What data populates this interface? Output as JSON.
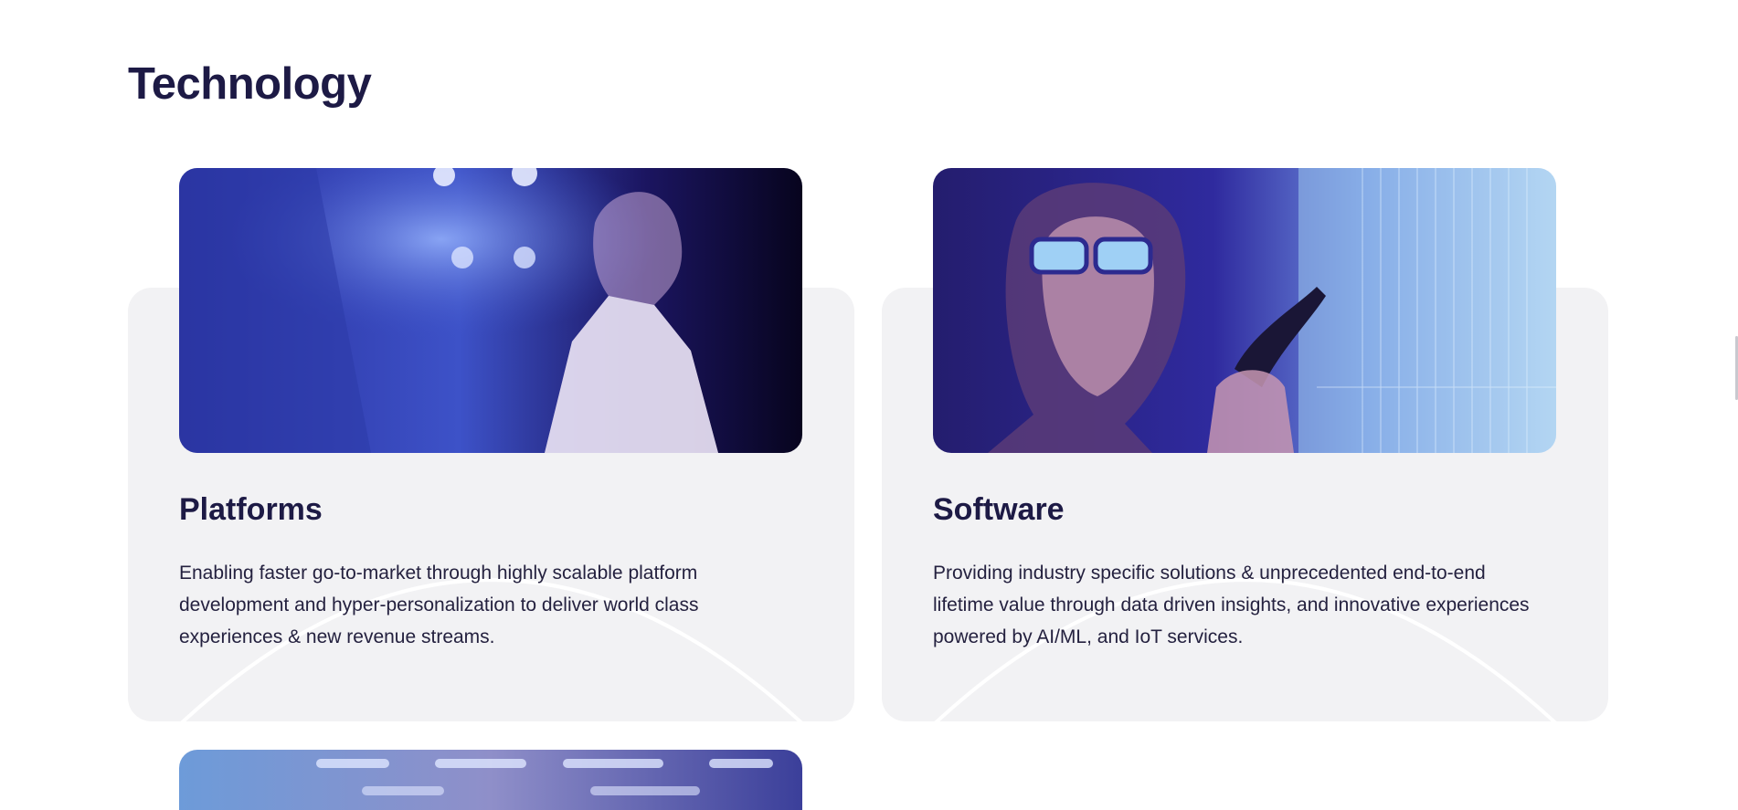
{
  "section": {
    "title": "Technology"
  },
  "cards": [
    {
      "title": "Platforms",
      "description": "Enabling faster go-to-market through highly scalable platform development and hyper-personalization to deliver world class experiences & new revenue streams."
    },
    {
      "title": "Software",
      "description": "Providing industry specific solutions & unprecedented end-to-end lifetime value through data driven insights, and innovative experiences powered by AI/ML, and IoT services."
    }
  ],
  "colors": {
    "heading": "#1d1a45",
    "card_background": "#f2f2f4",
    "image_tint_primary": "#2f2a9e",
    "image_tint_secondary": "#8fb8f0"
  }
}
